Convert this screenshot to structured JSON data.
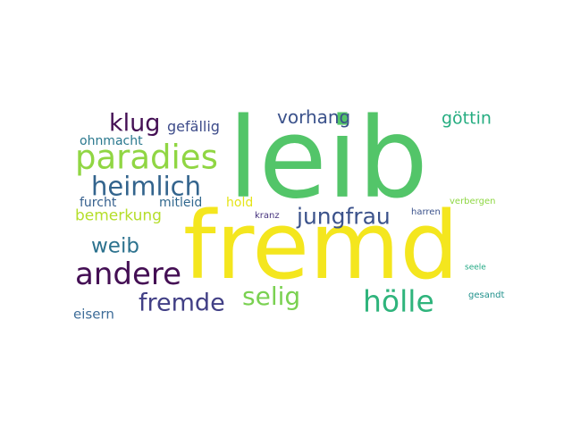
{
  "words": [
    {
      "text": "leib",
      "color": "#53c569"
    },
    {
      "text": "fremd",
      "color": "#f4e61e"
    },
    {
      "text": "paradies",
      "color": "#90d643"
    },
    {
      "text": "heimlich",
      "color": "#33648d"
    },
    {
      "text": "andere",
      "color": "#440f54"
    },
    {
      "text": "klug",
      "color": "#440f54"
    },
    {
      "text": "jungfrau",
      "color": "#3b528b"
    },
    {
      "text": "hölle",
      "color": "#2fb47c"
    },
    {
      "text": "fremde",
      "color": "#424086"
    },
    {
      "text": "selig",
      "color": "#7ad151"
    },
    {
      "text": "weib",
      "color": "#2c728e"
    },
    {
      "text": "vorhang",
      "color": "#3b528b"
    },
    {
      "text": "göttin",
      "color": "#26ad81"
    },
    {
      "text": "bemerkung",
      "color": "#b5de2b"
    },
    {
      "text": "gefällig",
      "color": "#3e4c8a"
    },
    {
      "text": "ohnmacht",
      "color": "#2a788e"
    },
    {
      "text": "furcht",
      "color": "#355f8d"
    },
    {
      "text": "mitleid",
      "color": "#31688e"
    },
    {
      "text": "hold",
      "color": "#e5e419"
    },
    {
      "text": "eisern",
      "color": "#3d6c98"
    },
    {
      "text": "kranz",
      "color": "#46337e"
    },
    {
      "text": "harren",
      "color": "#3b528b"
    },
    {
      "text": "verbergen",
      "color": "#8fd744"
    },
    {
      "text": "seele",
      "color": "#22a884"
    },
    {
      "text": "gesandt",
      "color": "#21918c"
    }
  ]
}
